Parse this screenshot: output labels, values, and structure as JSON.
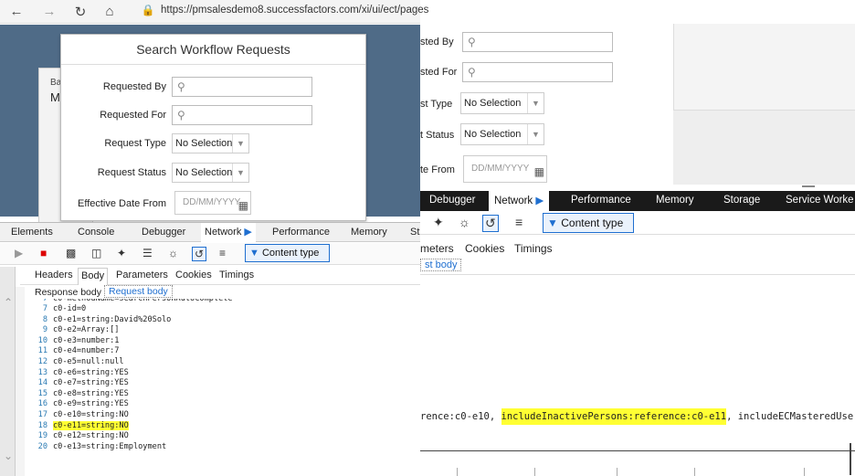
{
  "browser": {
    "back_icon": "back-arrow-icon",
    "url": "https://pmsalesdemo8.successfactors.com/xi/ui/ect/pages"
  },
  "background_fragments": {
    "left_a": "Ba",
    "left_b": "M"
  },
  "dialog": {
    "title": "Search Workflow Requests",
    "fields": {
      "requested_by": "Requested By",
      "requested_for": "Requested For",
      "request_type": "Request Type",
      "request_status": "Request Status",
      "effective_date_from": "Effective Date From"
    },
    "request_type_value": "No Selection",
    "request_status_value": "No Selection",
    "date_placeholder": "DD/MM/YYYY"
  },
  "devtools_left": {
    "tabs": [
      "Elements",
      "Console",
      "Debugger",
      "Network",
      "Performance",
      "Memory",
      "St"
    ],
    "active_tab": "Network",
    "content_type": "Content type",
    "subtabs": [
      "Headers",
      "Body",
      "Parameters",
      "Cookies",
      "Timings"
    ],
    "active_subtab": "Body",
    "body_tabs": [
      "Response body",
      "Request body"
    ],
    "code_lines": [
      {
        "n": "7",
        "t": "c0-methodName=searchPersonAutoComplete"
      },
      {
        "n": "7",
        "t": "c0-id=0"
      },
      {
        "n": "8",
        "t": "c0-e1=string:David%20Solo"
      },
      {
        "n": "9",
        "t": "c0-e2=Array:[]"
      },
      {
        "n": "10",
        "t": "c0-e3=number:1"
      },
      {
        "n": "11",
        "t": "c0-e4=number:7"
      },
      {
        "n": "12",
        "t": "c0-e5=null:null"
      },
      {
        "n": "13",
        "t": "c0-e6=string:YES"
      },
      {
        "n": "14",
        "t": "c0-e7=string:YES"
      },
      {
        "n": "15",
        "t": "c0-e8=string:YES"
      },
      {
        "n": "16",
        "t": "c0-e9=string:YES"
      },
      {
        "n": "17",
        "t": "c0-e10=string:NO"
      },
      {
        "n": "18",
        "t": "c0-e11=string:NO"
      },
      {
        "n": "19",
        "t": "c0-e12=string:NO"
      },
      {
        "n": "20",
        "t": "c0-e13=string:Employment"
      }
    ],
    "highlight_line_index": 12
  },
  "right_form": {
    "requested_by": "sted By",
    "requested_for": "sted For",
    "request_type": "st Type",
    "request_type_value": "No Selection",
    "request_status": "t Status",
    "request_status_value": "No Selection",
    "effective_date_from": "te From",
    "date_placeholder": "DD/MM/YYYY"
  },
  "devtools_right": {
    "tabs": [
      "Debugger",
      "Network",
      "Performance",
      "Memory",
      "Storage",
      "Service Worke"
    ],
    "active_tab": "Network",
    "content_type": "Content type",
    "subtabs": [
      "meters",
      "Cookies",
      "Timings"
    ],
    "request_body_tab": "st body",
    "code_before": "rence:c0-e10, ",
    "code_highlight": "includeInactivePersons:reference:c0-e11",
    "code_after": ", includeECMasteredUsersOn"
  },
  "colors": {
    "highlight": "#ffff33",
    "app_header": "#4f6b87",
    "devtools_dark": "#1a1a1a",
    "accent": "#1f6fd0"
  }
}
